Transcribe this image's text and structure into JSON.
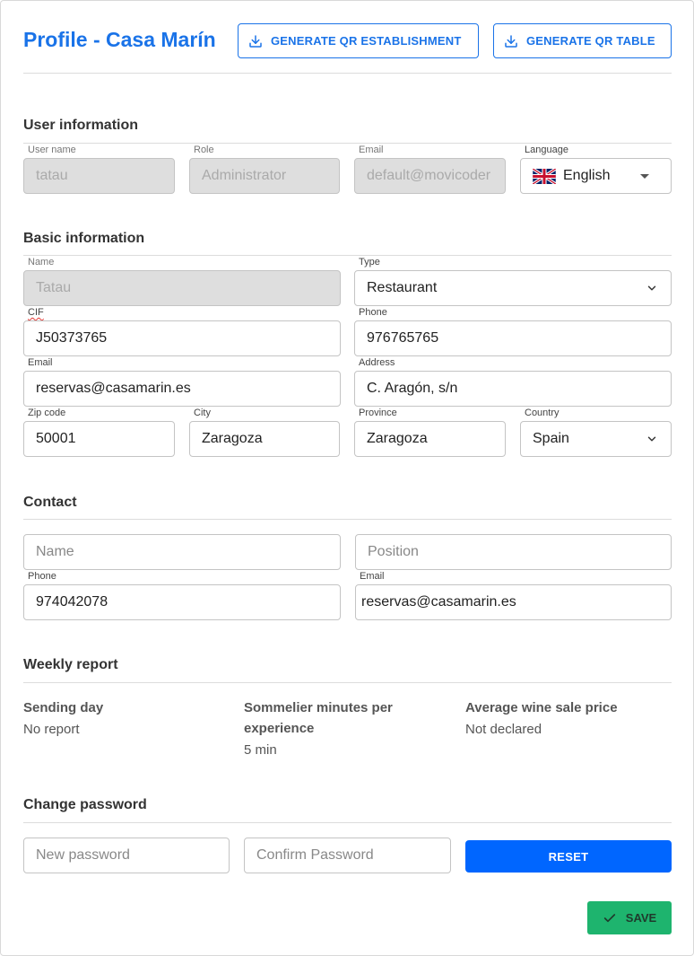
{
  "header": {
    "title": "Profile - Casa Marín",
    "qr_establishment_label": "GENERATE QR ESTABLISHMENT",
    "qr_table_label": "GENERATE QR TABLE"
  },
  "user_information": {
    "section_title": "User information",
    "username": {
      "label": "User name",
      "value": "tatau"
    },
    "role": {
      "label": "Role",
      "value": "Administrator"
    },
    "email": {
      "label": "Email",
      "value": "default@movicoder"
    },
    "language": {
      "label": "Language",
      "value": "English",
      "flag_icon": "uk-flag-icon"
    }
  },
  "basic_information": {
    "section_title": "Basic information",
    "name": {
      "label": "Name",
      "value": "Tatau"
    },
    "type": {
      "label": "Type",
      "value": "Restaurant"
    },
    "cif": {
      "label": "CIF",
      "value": "J50373765"
    },
    "phone": {
      "label": "Phone",
      "value": "976765765"
    },
    "email": {
      "label": "Email",
      "value": "reservas@casamarin.es"
    },
    "address": {
      "label": "Address",
      "value": "C. Aragón, s/n"
    },
    "zip": {
      "label": "Zip code",
      "value": "50001"
    },
    "city": {
      "label": "City",
      "value": "Zaragoza"
    },
    "province": {
      "label": "Province",
      "value": "Zaragoza"
    },
    "country": {
      "label": "Country",
      "value": "Spain"
    }
  },
  "contact": {
    "section_title": "Contact",
    "name": {
      "placeholder": "Name"
    },
    "position": {
      "placeholder": "Position"
    },
    "phone": {
      "label": "Phone",
      "value": "974042078"
    },
    "email": {
      "label": "Email",
      "value": "reservas@casamarin.es"
    }
  },
  "weekly_report": {
    "section_title": "Weekly report",
    "sending_day": {
      "label": "Sending day",
      "value": "No report"
    },
    "sommelier_minutes": {
      "label": "Sommelier minutes per experience",
      "value": "5 min"
    },
    "avg_wine_price": {
      "label": "Average wine sale price",
      "value": "Not declared"
    }
  },
  "change_password": {
    "section_title": "Change password",
    "new_password": {
      "placeholder": "New password"
    },
    "confirm_password": {
      "placeholder": "Confirm Password"
    },
    "reset_label": "RESET"
  },
  "footer": {
    "save_label": "SAVE"
  },
  "colors": {
    "accent": "#1a73e8",
    "reset_button": "#0066ff",
    "save_button": "#1eb46e",
    "disabled_field": "#dedede"
  }
}
